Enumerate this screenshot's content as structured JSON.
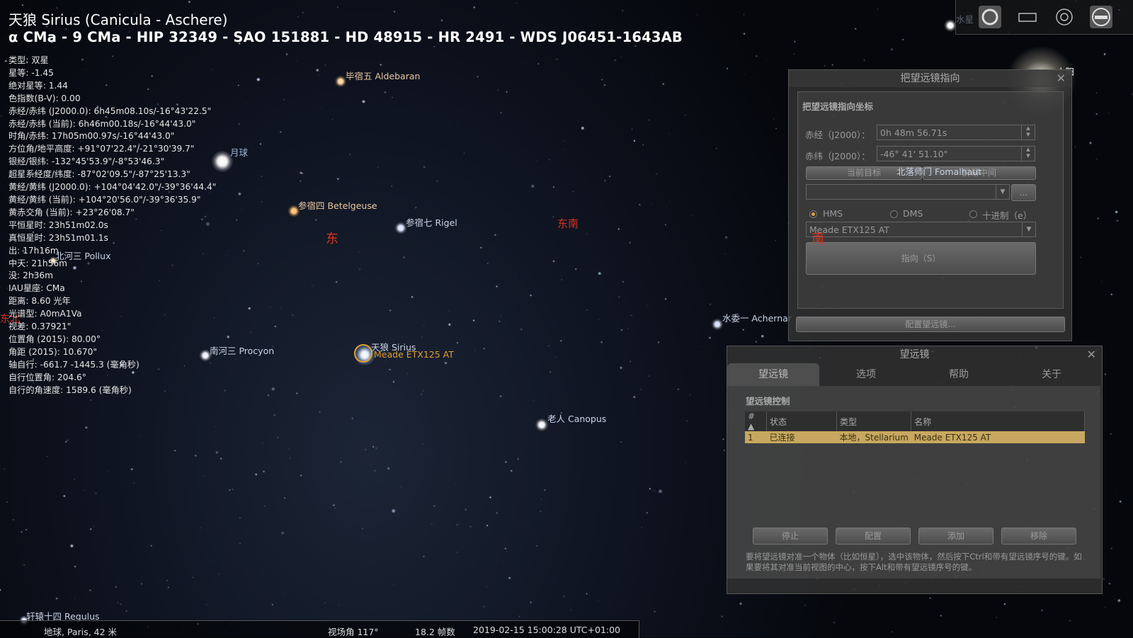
{
  "object": {
    "name_line": "天狼 Sirius (Canicula - Aschere)",
    "ids_line": "α CMa - 9 CMa - HIP 32349 - SAO 151881 - HD 48915 - HR 2491 - WDS J06451-1643AB",
    "info_lines": [
      "类型: 双星",
      "星等: -1.45",
      "绝对星等: 1.44",
      "色指数(B-V): 0.00",
      "赤经/赤纬 (J2000.0): 6h45m08.10s/-16°43'22.5\"",
      "赤经/赤纬 (当前): 6h46m00.18s/-16°44'43.0\"",
      "时角/赤纬: 17h05m00.97s/-16°44'43.0\"",
      "方位角/地平高度: +91°07'22.4\"/-21°30'39.7\"",
      "银经/银纬: -132°45'53.9\"/-8°53'46.3\"",
      "超星系经度/纬度: -87°02'09.5\"/-87°25'13.3\"",
      "黄经/黄纬 (J2000.0): +104°04'42.0\"/-39°36'44.4\"",
      "黄经/黄纬 (当前): +104°20'56.0\"/-39°36'35.9\"",
      "黄赤交角 (当前): +23°26'08.7\"",
      "平恒星时: 23h51m02.0s",
      "真恒星时: 23h51m01.1s",
      "出: 17h16m",
      "中天: 21h56m",
      "没: 2h36m",
      "IAU星座: CMa",
      "距离: 8.60 光年",
      "光谱型: A0mA1Va",
      "视差: 0.37921\"",
      "位置角 (2015): 80.00°",
      "角距 (2015): 10.670\"",
      "轴自行: -661.7 -1445.3 (毫角秒)",
      "自行位置角: 204.6°",
      "自行的角速度: 1589.6 (毫角秒)"
    ]
  },
  "sky_labels": {
    "aldebaran": "毕宿五 Aldebaran",
    "moon": "月球",
    "betelgeuse": "参宿四 Betelgeuse",
    "rigel": "参宿七 Rigel",
    "pollux": "北河三 Pollux",
    "procyon": "南河三 Procyon",
    "sirius": "天狼 Sirius",
    "telescope": "Meade ETX125 AT",
    "canopus": "老人 Canopus",
    "achernar": "水委一 Achernar",
    "fomalhaut": "北落师门 Fomalhaut",
    "regulus": "轩辕十四 Regulus",
    "mercury": "水星",
    "sun": "太阳",
    "east": "东",
    "southeast": "东南",
    "south": "南",
    "northeast": "东北"
  },
  "slew_dialog": {
    "title": "把望远镜指向",
    "section": "把望远镜指向坐标",
    "ra_label": "赤经（J2000）：",
    "ra_value": "0h 48m 56.71s",
    "dec_label": "赤纬（J2000）：",
    "dec_value": "-46° 41' 51.10\"",
    "current_target": "当前目标",
    "screen_center": "屏幕中间",
    "browse": "...",
    "hms": "HMS",
    "dms": "DMS",
    "decimal": "十进制（e）",
    "telescope_select": "Meade ETX125 AT",
    "slew_button": "指向（S）",
    "configure_button": "配置望远镜..."
  },
  "tele_dialog": {
    "title": "望远镜",
    "tabs": [
      "望远镜",
      "选项",
      "帮助",
      "关于"
    ],
    "section": "望远镜控制",
    "columns": [
      "#",
      "状态",
      "类型",
      "名称"
    ],
    "rows": [
      {
        "num": "1",
        "status": "已连接",
        "type": "本地，Stellarium",
        "name": "Meade ETX125 AT"
      }
    ],
    "buttons": [
      "停止",
      "配置",
      "添加",
      "移除"
    ],
    "help_text": "要将望远镜对准一个物体（比如恒星），选中该物体，然后按下Ctrl和带有望远镜序号的键。如果要将其对准当前视图的中心，按下Alt和带有望远镜序号的键。"
  },
  "status_bar": {
    "location": "地球, Paris, 42 米",
    "fov": "视场角 117°",
    "fps": "18.2 帧数",
    "datetime": "2019-02-15 15:00:28 UTC+01:00"
  },
  "toolbar": {
    "icons": [
      "circle-icon",
      "rectangle-icon",
      "target-icon",
      "telescope-icon"
    ]
  },
  "colors": {
    "accent": "#e0a030",
    "cardinal": "#e0321e",
    "selected_row": "#c8a860"
  }
}
